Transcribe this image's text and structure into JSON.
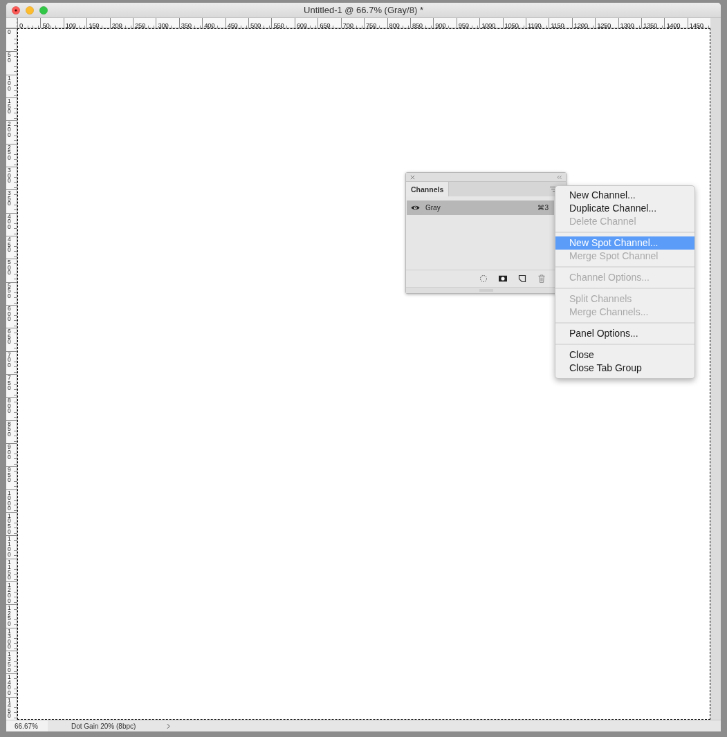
{
  "window": {
    "title": "Untitled-1 @ 66.7% (Gray/8) *"
  },
  "top_ruler": {
    "labels": [
      "0",
      "50",
      "100",
      "150",
      "200",
      "250",
      "300",
      "350",
      "400",
      "450",
      "500",
      "550",
      "600",
      "650",
      "700",
      "750",
      "800",
      "850",
      "900",
      "950",
      "1000",
      "1050",
      "1100",
      "1150",
      "1200",
      "1250",
      "1300",
      "1350",
      "1400",
      "1450"
    ]
  },
  "left_ruler": {
    "labels": [
      "0",
      "50",
      "100",
      "150",
      "200",
      "250",
      "300",
      "350",
      "400",
      "450",
      "500",
      "550",
      "600",
      "650",
      "700",
      "750",
      "800",
      "850",
      "900",
      "950",
      "1000",
      "1050",
      "1100",
      "1150",
      "1200",
      "1250",
      "1300",
      "1350",
      "1400",
      "1450"
    ]
  },
  "channels_panel": {
    "tabs": [
      {
        "label": "Channels",
        "selected": true
      }
    ],
    "channels": [
      {
        "name": "Gray",
        "shortcut": "⌘3",
        "visible": true,
        "selected": true
      }
    ]
  },
  "panel_menu": {
    "groups": [
      [
        {
          "label": "New Channel...",
          "disabled": false,
          "selected": false
        },
        {
          "label": "Duplicate Channel...",
          "disabled": false,
          "selected": false
        },
        {
          "label": "Delete Channel",
          "disabled": true,
          "selected": false
        }
      ],
      [
        {
          "label": "New Spot Channel...",
          "disabled": false,
          "selected": true
        },
        {
          "label": "Merge Spot Channel",
          "disabled": true,
          "selected": false
        }
      ],
      [
        {
          "label": "Channel Options...",
          "disabled": true,
          "selected": false
        }
      ],
      [
        {
          "label": "Split Channels",
          "disabled": true,
          "selected": false
        },
        {
          "label": "Merge Channels...",
          "disabled": true,
          "selected": false
        }
      ],
      [
        {
          "label": "Panel Options...",
          "disabled": false,
          "selected": false
        }
      ],
      [
        {
          "label": "Close",
          "disabled": false,
          "selected": false
        },
        {
          "label": "Close Tab Group",
          "disabled": false,
          "selected": false
        }
      ]
    ]
  },
  "status_bar": {
    "zoom": "66.67%",
    "info": "Dot Gain 20% (8bpc)"
  }
}
